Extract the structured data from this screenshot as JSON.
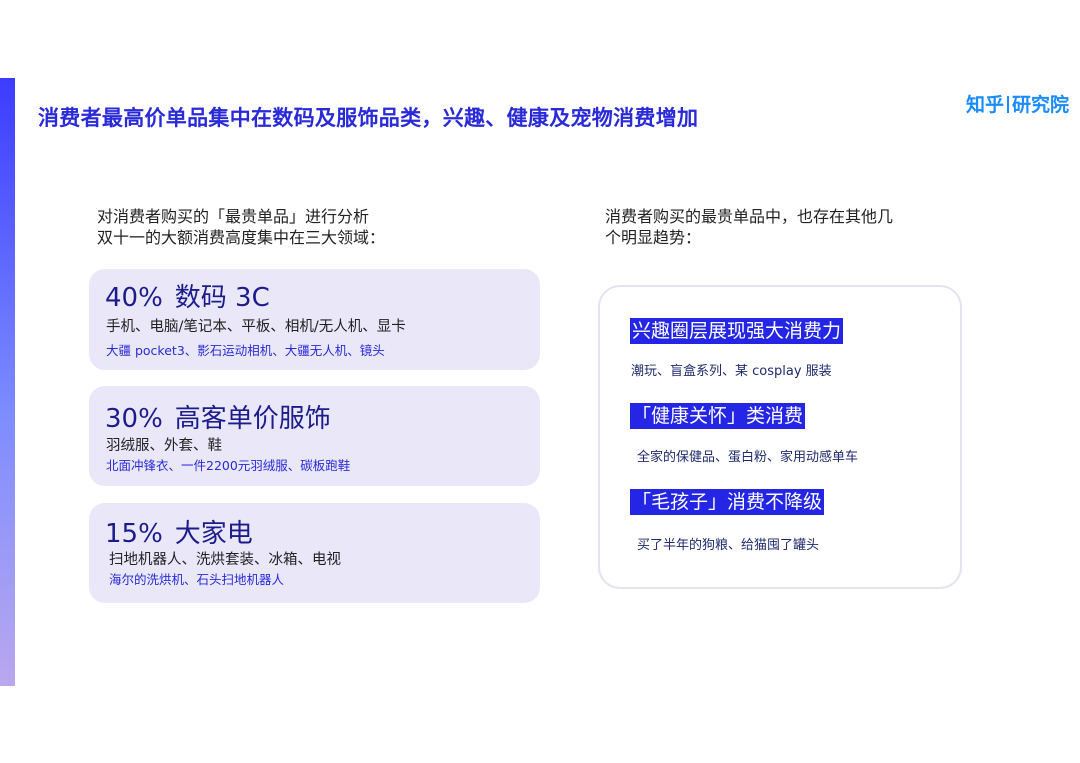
{
  "header": {
    "title": "消费者最高价单品集中在数码及服饰品类，兴趣、健康及宠物消费增加",
    "logo_left": "知乎",
    "logo_right": "研究院"
  },
  "left": {
    "intro_line1": "对消费者购买的「最贵单品」进行分析",
    "intro_line2": "双十一的大额消费高度集中在三大领域：",
    "categories": [
      {
        "percent": "40%",
        "name": "数码 3C",
        "items": "手机、电脑/笔记本、平板、相机/无人机、显卡",
        "examples": "大疆 pocket3、影石运动相机、大疆无人机、镜头"
      },
      {
        "percent": "30%",
        "name": "高客单价服饰",
        "items": "羽绒服、外套、鞋",
        "examples": "北面冲锋衣、一件2200元羽绒服、碳板跑鞋"
      },
      {
        "percent": "15%",
        "name": "大家电",
        "items": "扫地机器人、洗烘套装、冰箱、电视",
        "examples": "海尔的洗烘机、石头扫地机器人"
      }
    ]
  },
  "right": {
    "intro_line1": "消费者购买的最贵单品中，也存在其他几",
    "intro_line2": "个明显趋势：",
    "trends": [
      {
        "title": "兴趣圈层展现强大消费力",
        "desc": "潮玩、盲盒系列、某 cosplay 服装"
      },
      {
        "title": "「健康关怀」类消费",
        "desc": "全家的保健品、蛋白粉、家用动感单车"
      },
      {
        "title": "「毛孩子」消费不降级",
        "desc": "买了半年的狗粮、给猫囤了罐头"
      }
    ]
  },
  "colors": {
    "accent": "#2a2ad9",
    "card_bg": "#e9e7f8",
    "highlight": "#2525e6"
  }
}
